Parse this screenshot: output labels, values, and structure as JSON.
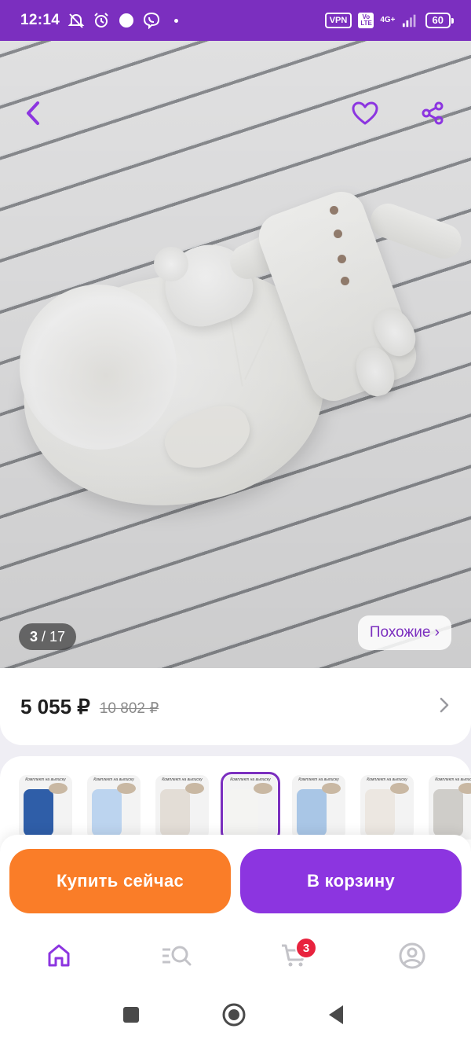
{
  "status_bar": {
    "time": "12:14",
    "vpn": "VPN",
    "volte": "Vo LTE",
    "network": "4G+",
    "battery": "60"
  },
  "gallery": {
    "current": "3",
    "separator": "/",
    "total": "17",
    "similar_label": "Похожие ›"
  },
  "product": {
    "price": "5 055 ₽",
    "old_price": "10 802 ₽"
  },
  "thumbnails": {
    "caption": "Комплект на выписку",
    "items": [
      {
        "color": "#2f5ea8",
        "active": false
      },
      {
        "color": "#bcd4ef",
        "active": false
      },
      {
        "color": "#e3ddd6",
        "active": false
      },
      {
        "color": "#f4f4f2",
        "active": true
      },
      {
        "color": "#a9c6e6",
        "active": false
      },
      {
        "color": "#ece7e1",
        "active": false
      },
      {
        "color": "#cfcdc9",
        "active": false
      }
    ]
  },
  "actions": {
    "buy_now": "Купить сейчас",
    "add_to_cart": "В корзину"
  },
  "nav": {
    "cart_badge": "3",
    "active_color": "#8c35e0",
    "inactive_color": "#c3c3c8"
  },
  "icons": [
    "back-icon",
    "heart-icon",
    "share-icon",
    "chevron-right-icon",
    "home-icon",
    "catalog-search-icon",
    "cart-icon",
    "profile-icon"
  ]
}
